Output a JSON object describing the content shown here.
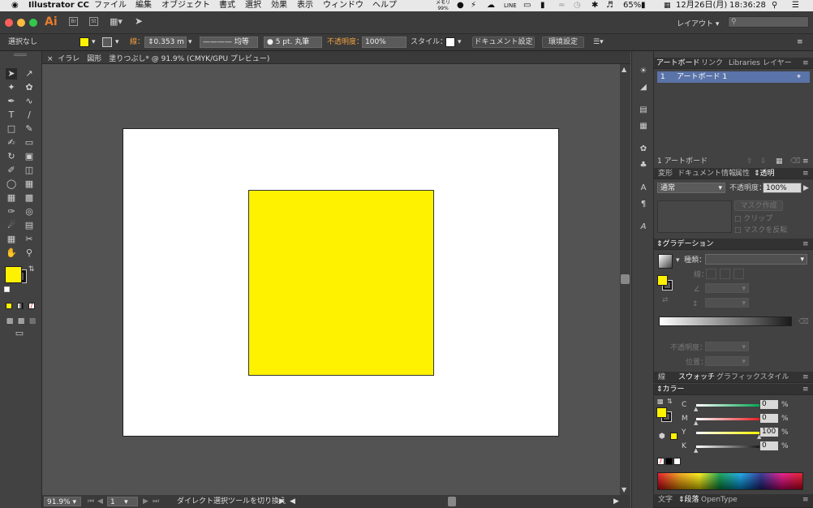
{
  "menubar": {
    "apple": "",
    "app_name": "Illustrator CC",
    "items": [
      "ファイル",
      "編集",
      "オブジェクト",
      "書式",
      "選択",
      "効果",
      "表示",
      "ウィンドウ",
      "ヘルプ"
    ],
    "memory": "メモリ",
    "memory_pct": "99%",
    "battery": "65%",
    "date": "12月26日(月)",
    "time": "18:36:28"
  },
  "appbar": {
    "logo": "Ai",
    "workspace": "レイアウト",
    "search_placeholder": ""
  },
  "controlbar": {
    "selection": "選択なし",
    "stroke_label": "線：",
    "stroke_value": "0.353 m",
    "stroke_profile": "均等",
    "brush": "5 pt. 丸筆",
    "opacity_label": "不透明度：",
    "opacity_value": "100%",
    "style_label": "スタイル：",
    "doc_settings": "ドキュメント設定",
    "prefs": "環境設定"
  },
  "document": {
    "tab_close": "×",
    "tab_title": "イラレ　図形　塗りつぶし* @ 91.9% (CMYK/GPU プレビュー)",
    "fill_color": "#fff200"
  },
  "statusbar": {
    "zoom": "91.9%",
    "artboard_num": "1",
    "tool_hint": "ダイレクト選択ツールを切り換え"
  },
  "panels": {
    "artboard_tabs": [
      "アートボード",
      "リンク",
      "Libraries",
      "レイヤー"
    ],
    "artboard_row_num": "1",
    "artboard_row_name": "アートボード 1",
    "artboard_count": "1 アートボード",
    "transform_tabs": [
      "変形",
      "ドキュメント情報",
      "属性",
      "透明"
    ],
    "blend_mode": "通常",
    "opacity_label": "不透明度：",
    "opacity_value": "100%",
    "mask_make": "マスク作成",
    "clip": "クリップ",
    "invert_mask": "マスクを反転",
    "gradient_title": "グラデーション",
    "gradient_type_label": "種類：",
    "gradient_stroke_label": "線：",
    "gradient_opacity_label": "不透明度：",
    "gradient_position_label": "位置：",
    "swatch_tabs": [
      "線",
      "スウォッチ",
      "グラフィックスタイル"
    ],
    "color_title": "カラー",
    "channels": [
      {
        "name": "C",
        "value": "0",
        "unit": "%",
        "level": 0,
        "color": "#00a651"
      },
      {
        "name": "M",
        "value": "0",
        "unit": "%",
        "level": 0,
        "color": "#ec1c24"
      },
      {
        "name": "Y",
        "value": "100",
        "unit": "%",
        "level": 100,
        "color": "#fff200"
      },
      {
        "name": "K",
        "value": "0",
        "unit": "%",
        "level": 0,
        "color": "#1a1a1a"
      }
    ],
    "bottom_tabs": [
      "文字",
      "段落",
      "OpenType"
    ]
  }
}
